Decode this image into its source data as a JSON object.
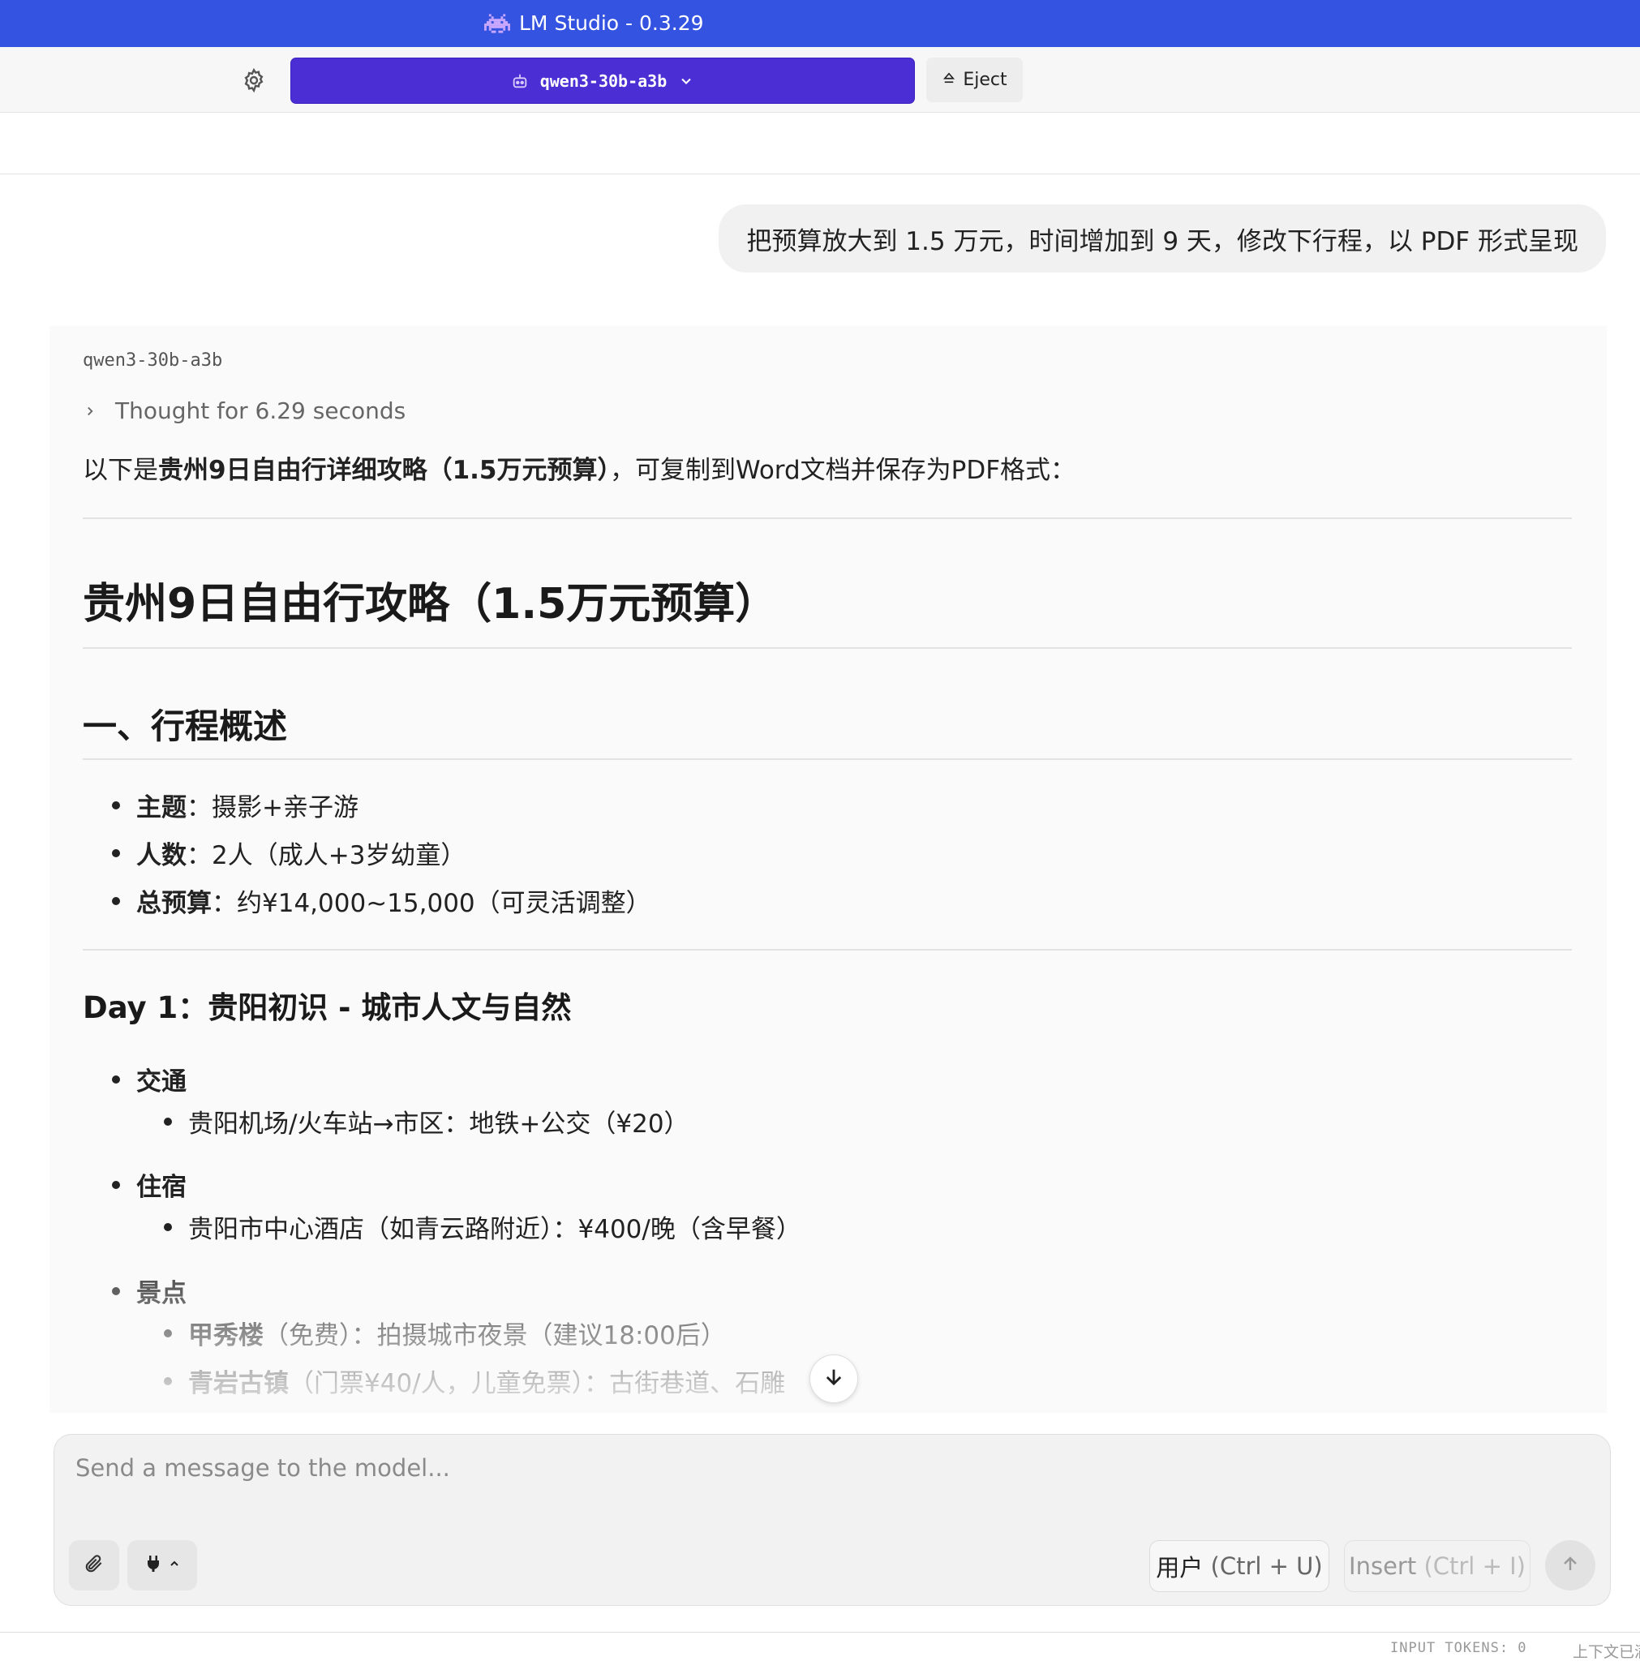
{
  "window": {
    "title": "LM Studio - 0.3.29",
    "icon": "space-invader-icon"
  },
  "toolbar": {
    "model": "qwen3-30b-a3b",
    "eject_label": "Eject"
  },
  "user_message": "把预算放大到 1.5 万元，时间增加到 9 天，修改下行程，以 PDF 形式呈现",
  "assistant": {
    "model_name": "qwen3-30b-a3b",
    "thought": "Thought for 6.29 seconds",
    "intro_pre": "以下是",
    "intro_bold": "贵州9日自由行详细攻略（1.5万元预算）",
    "intro_post": "，可复制到Word文档并保存为PDF格式：",
    "h1": "贵州9日自由行攻略（1.5万元预算）",
    "h2": "一、行程概述",
    "overview": [
      {
        "label": "主题",
        "text": "：摄影+亲子游"
      },
      {
        "label": "人数",
        "text": "：2人（成人+3岁幼童）"
      },
      {
        "label": "总预算",
        "text": "：约¥14,000~15,000（可灵活调整）"
      }
    ],
    "day1_title": "Day 1：贵阳初识 - 城市人文与自然",
    "day1": {
      "transport_label": "交通",
      "transport_item": "贵阳机场/火车站→市区：地铁+公交（¥20）",
      "lodging_label": "住宿",
      "lodging_item": "贵阳市中心酒店（如青云路附近）：¥400/晚（含早餐）",
      "spots_label": "景点",
      "spot1_name": "甲秀楼",
      "spot1_text": "（免费）：拍摄城市夜景（建议18:00后）",
      "spot2_name": "青岩古镇",
      "spot2_text": "（门票¥40/人，儿童免票）：古街巷道、石雕"
    }
  },
  "composer": {
    "placeholder": "Send a message to the model...",
    "role_label": "用户",
    "role_hint": "(Ctrl + U)",
    "insert_label": "Insert",
    "insert_hint": "(Ctrl + I)"
  },
  "status": {
    "tokens": "INPUT TOKENS:  0",
    "context": "上下文已满"
  }
}
